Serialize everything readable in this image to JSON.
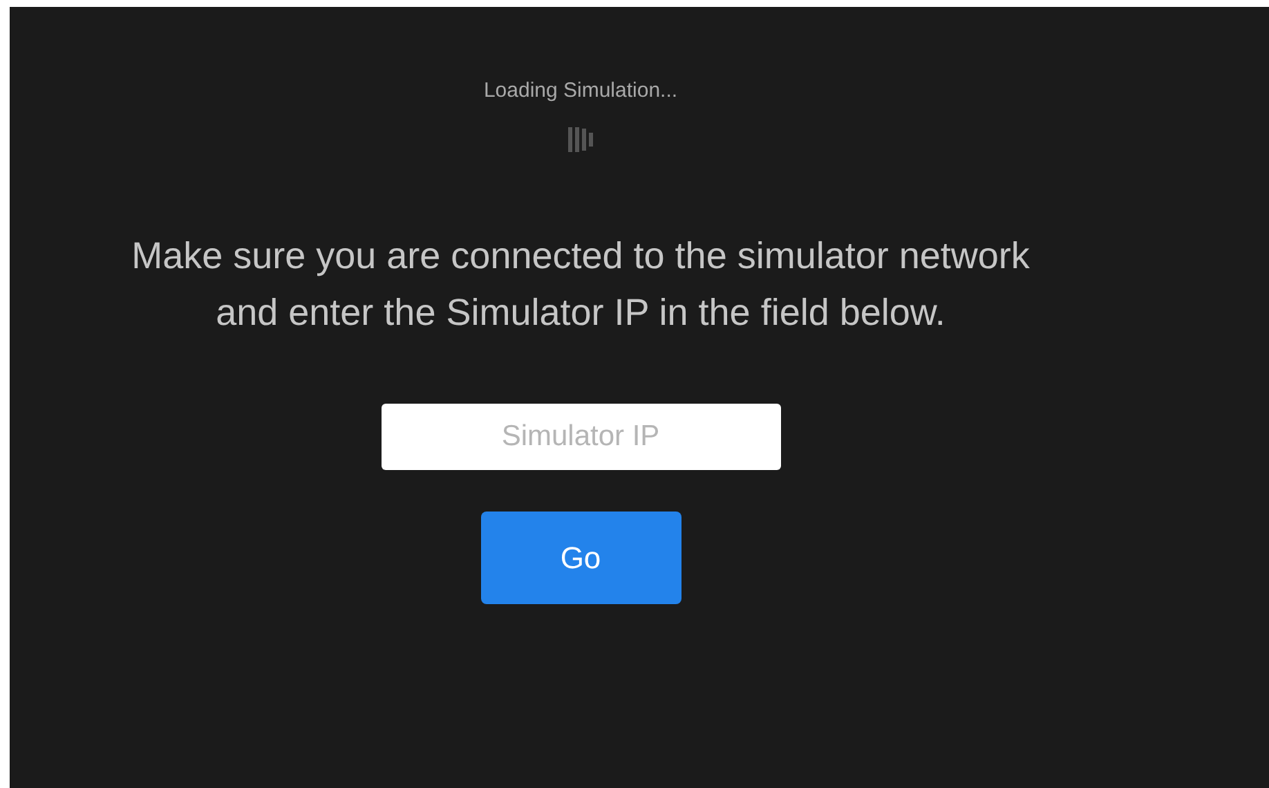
{
  "loading": {
    "label": "Loading Simulation..."
  },
  "message": "Make sure you are connected to the simulator network and enter the Simulator IP in the field below.",
  "ip_field": {
    "placeholder": "Simulator IP"
  },
  "go_button": {
    "label": "Go"
  }
}
